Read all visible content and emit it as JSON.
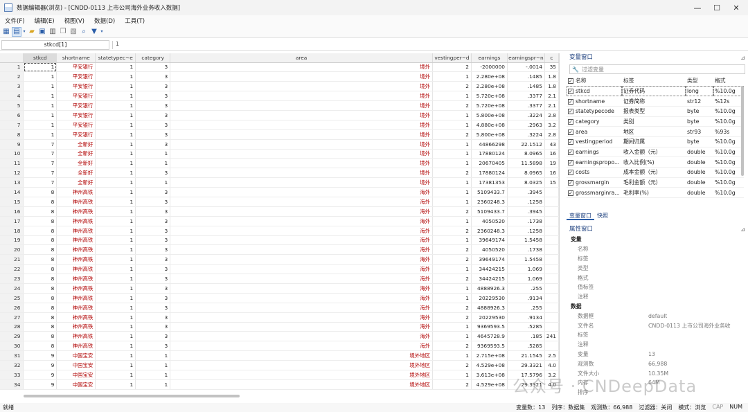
{
  "window": {
    "title": "数据编辑器(浏览) - [CNDD-0113  上市公司海外业务收入数据]",
    "minimize": "—",
    "maximize": "☐",
    "close": "✕"
  },
  "menu": [
    "文件(F)",
    "编辑(E)",
    "视图(V)",
    "数据(D)",
    "工具(T)"
  ],
  "cellbar": {
    "name": "stkcd[1]",
    "value": "1"
  },
  "grid": {
    "columns": [
      "stkcd",
      "shortname",
      "statetypec~e",
      "category",
      "area",
      "vestingper~d",
      "earnings",
      "earningspr~n",
      "c"
    ],
    "rows": [
      [
        "1",
        "1",
        "平安银行",
        "1",
        "3",
        "境外",
        "2",
        "-2000000",
        "-.0014",
        "35"
      ],
      [
        "2",
        "1",
        "平安银行",
        "1",
        "3",
        "境外",
        "1",
        "2.280e+08",
        ".1485",
        "1.8"
      ],
      [
        "3",
        "1",
        "平安银行",
        "1",
        "3",
        "境外",
        "2",
        "2.280e+08",
        ".1485",
        "1.8"
      ],
      [
        "4",
        "1",
        "平安银行",
        "1",
        "3",
        "境外",
        "1",
        "5.720e+08",
        ".3377",
        "2.1"
      ],
      [
        "5",
        "1",
        "平安银行",
        "1",
        "3",
        "境外",
        "2",
        "5.720e+08",
        ".3377",
        "2.1"
      ],
      [
        "6",
        "1",
        "平安银行",
        "1",
        "3",
        "境外",
        "1",
        "5.800e+08",
        ".3224",
        "2.8"
      ],
      [
        "7",
        "1",
        "平安银行",
        "1",
        "3",
        "境外",
        "1",
        "4.880e+08",
        ".2963",
        "3.2"
      ],
      [
        "8",
        "1",
        "平安银行",
        "1",
        "3",
        "境外",
        "2",
        "5.800e+08",
        ".3224",
        "2.8"
      ],
      [
        "9",
        "7",
        "全新好",
        "1",
        "3",
        "境外",
        "1",
        "44866298",
        "22.1512",
        "43"
      ],
      [
        "10",
        "7",
        "全新好",
        "1",
        "1",
        "境外",
        "1",
        "17880124",
        "8.0965",
        "16"
      ],
      [
        "11",
        "7",
        "全新好",
        "1",
        "1",
        "境外",
        "1",
        "20670405",
        "11.5898",
        "19"
      ],
      [
        "12",
        "7",
        "全新好",
        "1",
        "3",
        "境外",
        "2",
        "17880124",
        "8.0965",
        "16"
      ],
      [
        "13",
        "7",
        "全新好",
        "1",
        "1",
        "境外",
        "1",
        "17381353",
        "8.0325",
        "15"
      ],
      [
        "14",
        "8",
        "神州高铁",
        "1",
        "3",
        "海外",
        "1",
        "5109433.7",
        ".3945",
        ""
      ],
      [
        "15",
        "8",
        "神州高铁",
        "1",
        "3",
        "海外",
        "1",
        "2360248.3",
        ".1258",
        ""
      ],
      [
        "16",
        "8",
        "神州高铁",
        "1",
        "3",
        "海外",
        "2",
        "5109433.7",
        ".3945",
        ""
      ],
      [
        "17",
        "8",
        "神州高铁",
        "1",
        "3",
        "海外",
        "1",
        "4050520",
        ".1738",
        ""
      ],
      [
        "18",
        "8",
        "神州高铁",
        "1",
        "3",
        "海外",
        "2",
        "2360248.3",
        ".1258",
        ""
      ],
      [
        "19",
        "8",
        "神州高铁",
        "1",
        "3",
        "海外",
        "1",
        "39649174",
        "1.5458",
        ""
      ],
      [
        "20",
        "8",
        "神州高铁",
        "1",
        "3",
        "海外",
        "2",
        "4050520",
        ".1738",
        ""
      ],
      [
        "21",
        "8",
        "神州高铁",
        "1",
        "3",
        "海外",
        "2",
        "39649174",
        "1.5458",
        ""
      ],
      [
        "22",
        "8",
        "神州高铁",
        "1",
        "3",
        "海外",
        "1",
        "34424215",
        "1.069",
        ""
      ],
      [
        "23",
        "8",
        "神州高铁",
        "1",
        "3",
        "海外",
        "2",
        "34424215",
        "1.069",
        ""
      ],
      [
        "24",
        "8",
        "神州高铁",
        "1",
        "3",
        "海外",
        "1",
        "4888926.3",
        ".255",
        ""
      ],
      [
        "25",
        "8",
        "神州高铁",
        "1",
        "3",
        "海外",
        "1",
        "20229530",
        ".9134",
        ""
      ],
      [
        "26",
        "8",
        "神州高铁",
        "1",
        "3",
        "海外",
        "2",
        "4888926.3",
        ".255",
        ""
      ],
      [
        "27",
        "8",
        "神州高铁",
        "1",
        "3",
        "海外",
        "2",
        "20229530",
        ".9134",
        ""
      ],
      [
        "28",
        "8",
        "神州高铁",
        "1",
        "3",
        "海外",
        "1",
        "9369593.5",
        ".5285",
        ""
      ],
      [
        "29",
        "8",
        "神州高铁",
        "1",
        "3",
        "海外",
        "1",
        "4645728.9",
        ".185",
        "241"
      ],
      [
        "30",
        "8",
        "神州高铁",
        "1",
        "3",
        "海外",
        "2",
        "9369593.5",
        ".5285",
        ""
      ],
      [
        "31",
        "9",
        "中国宝安",
        "1",
        "1",
        "境外地区",
        "1",
        "2.715e+08",
        "21.1545",
        "2.5"
      ],
      [
        "32",
        "9",
        "中国宝安",
        "1",
        "1",
        "境外地区",
        "2",
        "4.529e+08",
        "29.3321",
        "4.0"
      ],
      [
        "33",
        "9",
        "中国宝安",
        "1",
        "1",
        "境外地区",
        "1",
        "3.613e+08",
        "17.5796",
        "3.2"
      ],
      [
        "34",
        "9",
        "中国宝安",
        "1",
        "1",
        "境外地区",
        "2",
        "4.529e+08",
        "29.3321",
        "4.0"
      ]
    ]
  },
  "variables_panel": {
    "title": "变量窗口",
    "filter_placeholder": "过滤变量",
    "headers": [
      "名称",
      "标签",
      "类型",
      "格式"
    ],
    "rows": [
      [
        "stkcd",
        "证券代码",
        "long",
        "%10.0g"
      ],
      [
        "shortname",
        "证券简称",
        "str12",
        "%12s"
      ],
      [
        "statetypecode",
        "报表类型",
        "byte",
        "%10.0g"
      ],
      [
        "category",
        "类别",
        "byte",
        "%10.0g"
      ],
      [
        "area",
        "地区",
        "str93",
        "%93s"
      ],
      [
        "vestingperiod",
        "期间归属",
        "byte",
        "%10.0g"
      ],
      [
        "earnings",
        "收入金额（元）",
        "double",
        "%10.0g"
      ],
      [
        "earningspropo...",
        "收入比例(%)",
        "double",
        "%10.0g"
      ],
      [
        "costs",
        "成本金额（元）",
        "double",
        "%10.0g"
      ],
      [
        "grossmargin",
        "毛利金额（元）",
        "double",
        "%10.0g"
      ],
      [
        "grossmarginra...",
        "毛利率(%)",
        "double",
        "%10.0g"
      ]
    ]
  },
  "tabs": [
    "变量窗口",
    "快照"
  ],
  "properties_panel": {
    "title": "属性窗口",
    "sections": [
      {
        "name": "变量",
        "items": [
          [
            "名称",
            ""
          ],
          [
            "标签",
            ""
          ],
          [
            "类型",
            ""
          ],
          [
            "格式",
            ""
          ],
          [
            "值标签",
            ""
          ],
          [
            "注释",
            ""
          ]
        ]
      },
      {
        "name": "数据",
        "items": [
          [
            "数据框",
            "default"
          ],
          [
            "文件名",
            "CNDD-0113  上市公司海外业务收"
          ],
          [
            "标签",
            ""
          ],
          [
            "注释",
            ""
          ],
          [
            "变量",
            "13"
          ],
          [
            "观测数",
            "66,988"
          ],
          [
            "文件大小",
            "10.35M"
          ],
          [
            "内存",
            "64M"
          ],
          [
            "排序",
            ""
          ]
        ]
      }
    ]
  },
  "status": {
    "left": "就绪",
    "vars": "变量数：13",
    "order": "列序：数据集",
    "obs": "观测数：66,988",
    "filter": "过滤器：关闭",
    "mode": "模式：浏览",
    "cap": "CAP",
    "num": "NUM"
  },
  "watermark": "公众号 · CNDeepData"
}
